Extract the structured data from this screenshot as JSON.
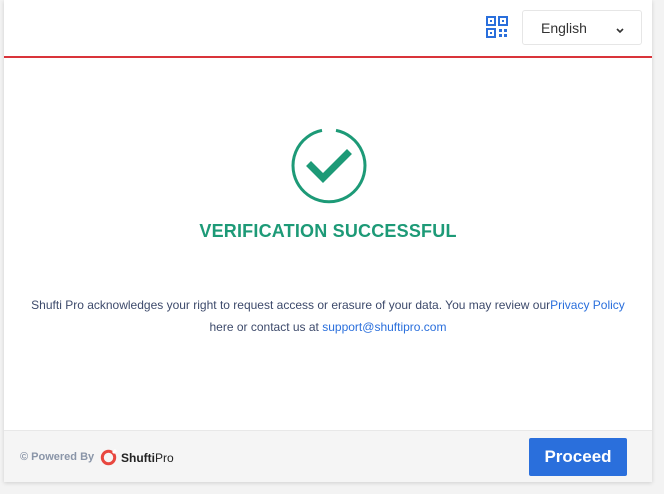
{
  "header": {
    "qr_icon": "qr-code-icon",
    "language": "English"
  },
  "status": {
    "icon": "check-circle-icon",
    "title": "VERIFICATION SUCCESSFUL"
  },
  "notice": {
    "text_before": "Shufti Pro acknowledges your right to request access or erasure of your data. You may review our",
    "privacy_link": "Privacy Policy",
    "text_middle": " here or contact us at ",
    "support_email": "support@shuftipro.com"
  },
  "footer": {
    "powered_by": "© Powered By",
    "logo_brand": "Shufti",
    "logo_suffix": "Pro",
    "proceed_label": "Proceed"
  },
  "colors": {
    "accent_red": "#d9343a",
    "success_green": "#1d9a77",
    "primary_blue": "#2a6fdc"
  }
}
